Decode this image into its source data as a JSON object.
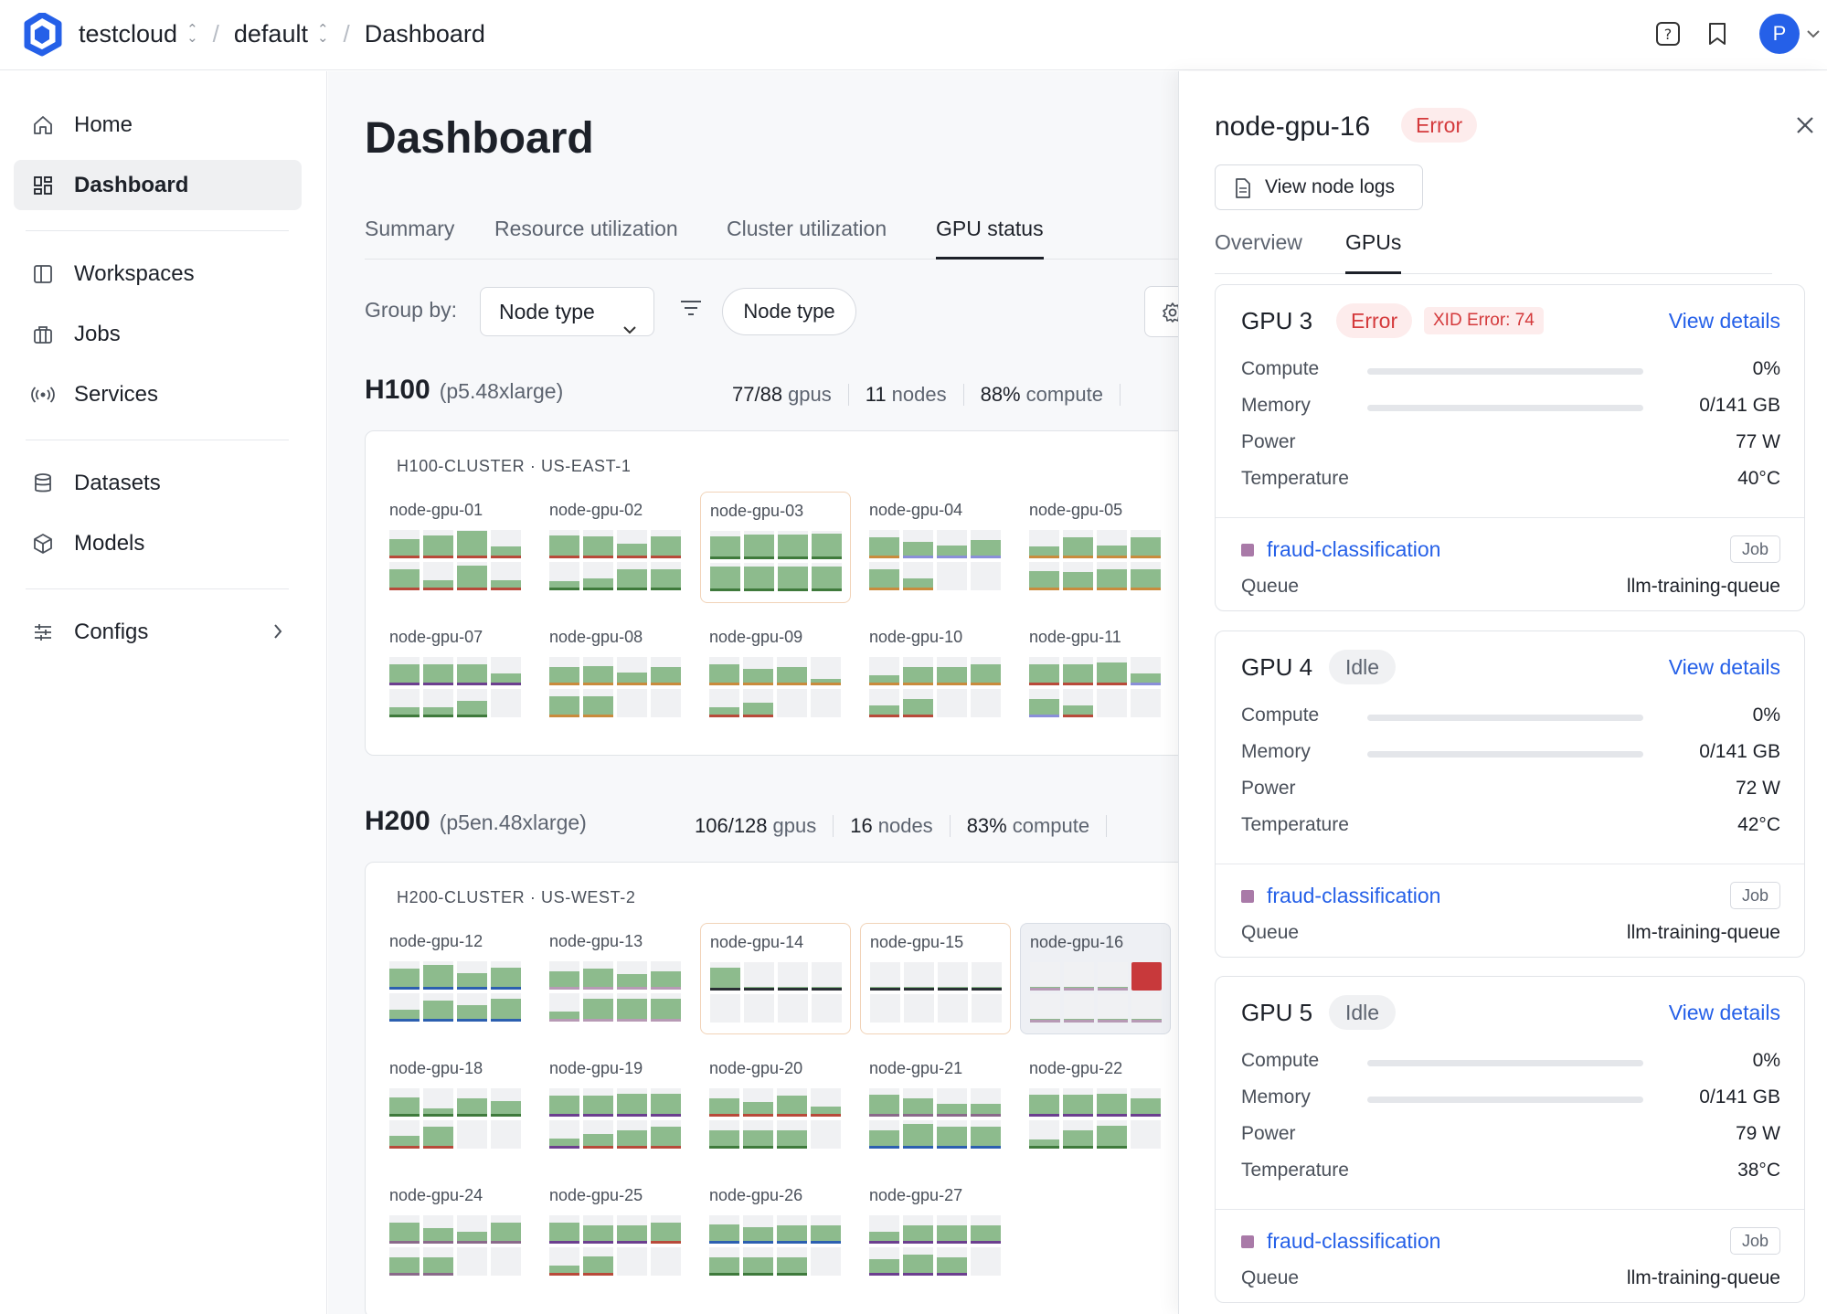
{
  "topbar": {
    "org": "testcloud",
    "project": "default",
    "page": "Dashboard",
    "avatar_initial": "P",
    "icons": [
      "help-icon",
      "bookmark-icon",
      "chevron-down-icon"
    ]
  },
  "sidebar": {
    "items": [
      {
        "label": "Home",
        "icon": "home-icon"
      },
      {
        "label": "Dashboard",
        "icon": "dashboard-icon",
        "active": true
      },
      {
        "label": "Workspaces",
        "icon": "workspaces-icon"
      },
      {
        "label": "Jobs",
        "icon": "jobs-icon"
      },
      {
        "label": "Services",
        "icon": "services-icon"
      },
      {
        "label": "Datasets",
        "icon": "datasets-icon"
      },
      {
        "label": "Models",
        "icon": "models-icon"
      },
      {
        "label": "Configs",
        "icon": "configs-icon"
      }
    ]
  },
  "main": {
    "title": "Dashboard",
    "tabs": [
      "Summary",
      "Resource utilization",
      "Cluster utilization",
      "GPU status"
    ],
    "active_tab": "GPU status",
    "group_by_label": "Group by:",
    "group_by_value": "Node type",
    "filter_pill": "Node type",
    "groups": [
      {
        "name": "H100",
        "instance": "(p5.48xlarge)",
        "stats": [
          {
            "value": "77/88",
            "unit": "gpus"
          },
          {
            "value": "11",
            "unit": "nodes"
          },
          {
            "value": "88%",
            "unit": "compute"
          }
        ],
        "cluster": "H100-CLUSTER · US-EAST-1",
        "nodes": [
          "node-gpu-01",
          "node-gpu-02",
          "node-gpu-03",
          "node-gpu-04",
          "node-gpu-05",
          "node-gpu-07",
          "node-gpu-08",
          "node-gpu-09",
          "node-gpu-10",
          "node-gpu-11"
        ]
      },
      {
        "name": "H200",
        "instance": "(p5en.48xlarge)",
        "stats": [
          {
            "value": "106/128",
            "unit": "gpus"
          },
          {
            "value": "16",
            "unit": "nodes"
          },
          {
            "value": "83%",
            "unit": "compute"
          }
        ],
        "cluster": "H200-CLUSTER · US-WEST-2",
        "nodes": [
          "node-gpu-12",
          "node-gpu-13",
          "node-gpu-14",
          "node-gpu-15",
          "node-gpu-16",
          "node-gpu-18",
          "node-gpu-19",
          "node-gpu-20",
          "node-gpu-21",
          "node-gpu-22",
          "node-gpu-24",
          "node-gpu-25",
          "node-gpu-26",
          "node-gpu-27"
        ]
      }
    ]
  },
  "panel": {
    "title": "node-gpu-16",
    "status": "Error",
    "logs_button": "View node logs",
    "tabs": [
      "Overview",
      "GPUs"
    ],
    "active_tab": "GPUs",
    "metric_labels": [
      "Compute",
      "Memory",
      "Power",
      "Temperature"
    ],
    "view_details": "View details",
    "job_tag": "Job",
    "queue_label": "Queue",
    "gpus": [
      {
        "name": "GPU 3",
        "status": "Error",
        "xid": "XID Error: 74",
        "compute": "0%",
        "memory": "0/141 GB",
        "power": "77 W",
        "temperature": "40°C",
        "job": "fraud-classification",
        "queue": "llm-training-queue"
      },
      {
        "name": "GPU 4",
        "status": "Idle",
        "xid": "",
        "compute": "0%",
        "memory": "0/141 GB",
        "power": "72 W",
        "temperature": "42°C",
        "job": "fraud-classification",
        "queue": "llm-training-queue"
      },
      {
        "name": "GPU 5",
        "status": "Idle",
        "xid": "",
        "compute": "0%",
        "memory": "0/141 GB",
        "power": "79 W",
        "temperature": "38°C",
        "job": "fraud-classification",
        "queue": "llm-training-queue"
      }
    ]
  },
  "colors": {
    "accent": "#2560e8",
    "error": "#d4393b",
    "gpu_fill": "#8dbb8d",
    "gpu_empty": "#f0f1f3",
    "job_color": "#a97aa8"
  }
}
